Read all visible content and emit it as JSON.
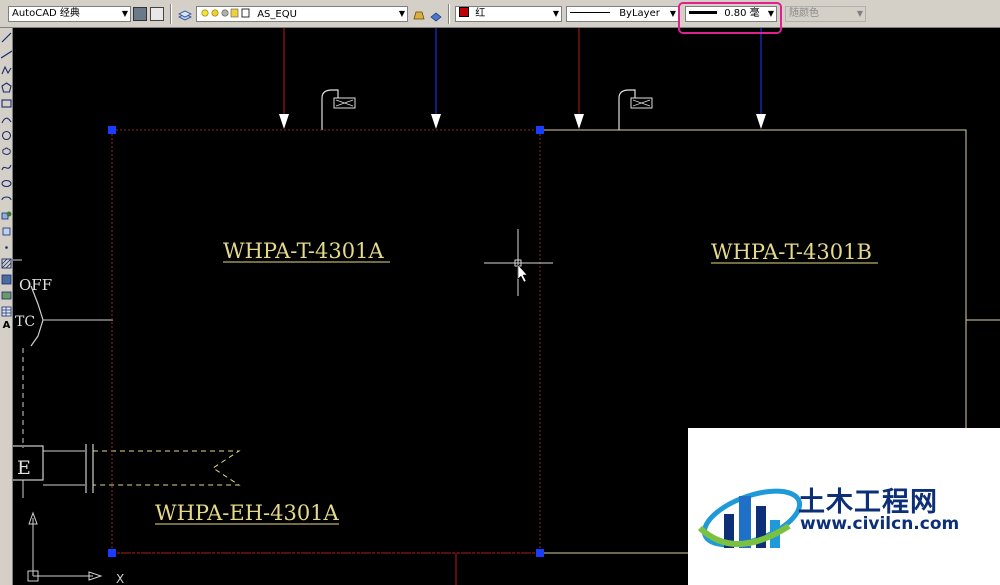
{
  "toolbar": {
    "workspace": "AutoCAD 经典",
    "layer": "AS_EQU",
    "color": {
      "label": "红",
      "swatch": "#c00000"
    },
    "linetype": "ByLayer",
    "lineweight": "0.80 毫",
    "plotstyle": "随颜色"
  },
  "canvas": {
    "labels": {
      "tank_a": "WHPA-T-4301A",
      "tank_b": "WHPA-T-4301B",
      "heater": "WHPA-EH-4301A",
      "off_text": "OFF",
      "tc_text": "TC",
      "e_text": "E",
      "axis_x": "X"
    },
    "colors": {
      "background": "#000000",
      "text_yellow": "#e6d98a",
      "grip_blue": "#1a3cff",
      "highlight_magenta": "#e0208c"
    }
  },
  "left_toolbar": {
    "icons": [
      "line-icon",
      "construction-line-icon",
      "polyline-icon",
      "polygon-icon",
      "rectangle-icon",
      "arc-icon",
      "circle-icon",
      "revision-cloud-icon",
      "spline-icon",
      "ellipse-icon",
      "ellipse-arc-icon",
      "insert-block-icon",
      "make-block-icon",
      "point-icon",
      "hatch-icon",
      "gradient-icon",
      "region-icon",
      "table-icon",
      "mtext-icon"
    ],
    "text_tool": "A"
  },
  "watermark": {
    "title": "土木工程网",
    "url": "www.civilcn.com"
  }
}
